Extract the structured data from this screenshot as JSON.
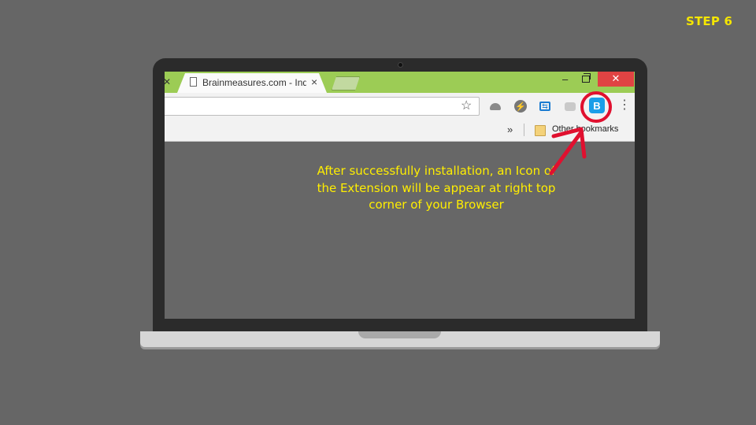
{
  "step": {
    "label": "STEP 6"
  },
  "browser": {
    "tab": {
      "title": "Brainmeasures.com - Ind",
      "close_glyph": "×"
    },
    "window_controls": {
      "minimize": "–",
      "close": "✕"
    },
    "toolbar": {
      "star_icon": "☆",
      "menu_icon": "⋮",
      "extensions": [
        {
          "name": "hat-extension-icon"
        },
        {
          "name": "bolt-extension-icon",
          "glyph": "⚡"
        },
        {
          "name": "translate-extension-icon",
          "glyph": "⇆"
        },
        {
          "name": "chat-extension-icon"
        },
        {
          "name": "brainmeasures-extension-icon",
          "glyph": "B"
        }
      ]
    },
    "bookmarks_bar": {
      "overflow": "»",
      "folder_label": "Other bookmarks"
    }
  },
  "annotation": {
    "text": "After successfully installation, an Icon of the Extension will be appear at right top corner of your Browser",
    "highlight_color": "#e0102f",
    "text_color": "#ffee00"
  }
}
